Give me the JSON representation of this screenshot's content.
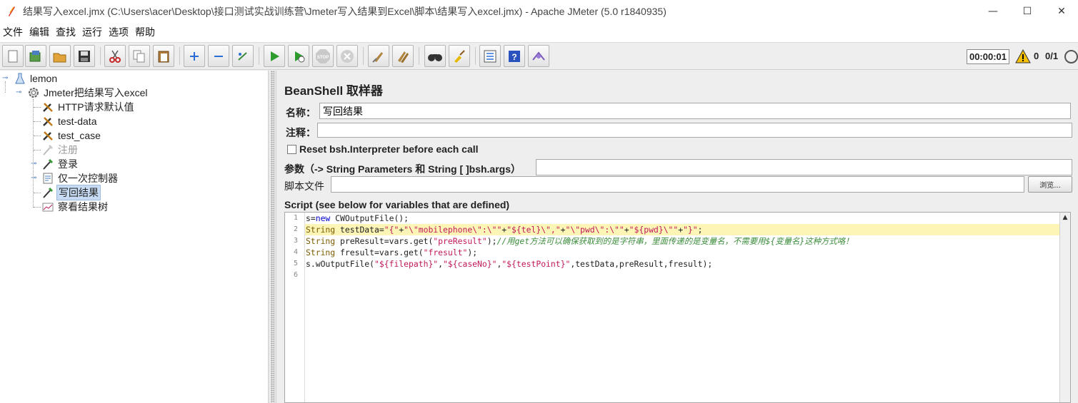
{
  "window": {
    "title": "结果写入excel.jmx (C:\\Users\\acer\\Desktop\\接口测试实战训练营\\Jmeter写入结果到Excel\\脚本\\结果写入excel.jmx) - Apache JMeter (5.0 r1840935)",
    "minimize": "—",
    "maximize": "☐",
    "close": "✕"
  },
  "menu": [
    "文件",
    "编辑",
    "查找",
    "运行",
    "选项",
    "帮助"
  ],
  "toolbar": {
    "icons": [
      "new-icon",
      "templates-icon",
      "open-icon",
      "save-icon",
      "cut-icon",
      "copy-icon",
      "paste-icon",
      "expand-icon",
      "collapse-icon",
      "toggle-icon",
      "start-icon",
      "start-no-timers-icon",
      "stop-icon",
      "shutdown-icon",
      "clear-icon",
      "clear-all-icon",
      "search-icon",
      "reset-search-icon",
      "function-helper-icon",
      "help-icon",
      "remote-icon"
    ],
    "stop_label": "STOP",
    "timer": "00:00:01",
    "warning_count": "0",
    "threads": "0/1"
  },
  "tree": {
    "nodes": [
      {
        "label": "lemon",
        "icon": "flask-icon"
      },
      {
        "label": "Jmeter把结果写入excel",
        "icon": "gear-icon"
      },
      {
        "label": "HTTP请求默认值",
        "icon": "wrench-icon"
      },
      {
        "label": "test-data",
        "icon": "wrench-icon"
      },
      {
        "label": "test_case",
        "icon": "wrench-icon"
      },
      {
        "label": "注册",
        "icon": "pipette-icon"
      },
      {
        "label": "登录",
        "icon": "pipette-icon"
      },
      {
        "label": "仅一次控制器",
        "icon": "controller-icon"
      },
      {
        "label": "写回结果",
        "icon": "pipette-icon"
      },
      {
        "label": "察看结果树",
        "icon": "chart-icon"
      }
    ]
  },
  "panel": {
    "title": "BeanShell 取样器",
    "name_label": "名称：",
    "name_value": "写回结果",
    "comment_label": "注释：",
    "comment_value": "",
    "reset_label": "Reset bsh.Interpreter before each call",
    "params_label": "参数（-> String Parameters 和 String [ ]bsh.args）",
    "params_value": "",
    "script_file_label": "脚本文件",
    "script_file_value": "",
    "browse_label": "浏览...",
    "script_label": "Script (see below for variables that are defined)"
  },
  "editor": {
    "line_numbers": [
      "1",
      "2",
      "3",
      "4",
      "5",
      "6"
    ],
    "lines": [
      "s=new CWOutputFile();",
      "String testData=\"{\"+\"\\\"mobilephone\\\":\\\"\"+\"${tel}\\\",\"+\"\\\"pwd\\\":\\\"\"+\"${pwd}\\\"\"+\"}\";",
      "String preResult=vars.get(\"preResult\");//用get方法可以确保获取到的是字符串，里面传递的是变量名，不需要用${变量名}这种方式咯！",
      "String fresult=vars.get(\"fresult\");",
      "s.wOutputFile(\"${filepath}\",\"${caseNo}\",\"${testPoint}\",testData,preResult,fresult);",
      ""
    ]
  }
}
